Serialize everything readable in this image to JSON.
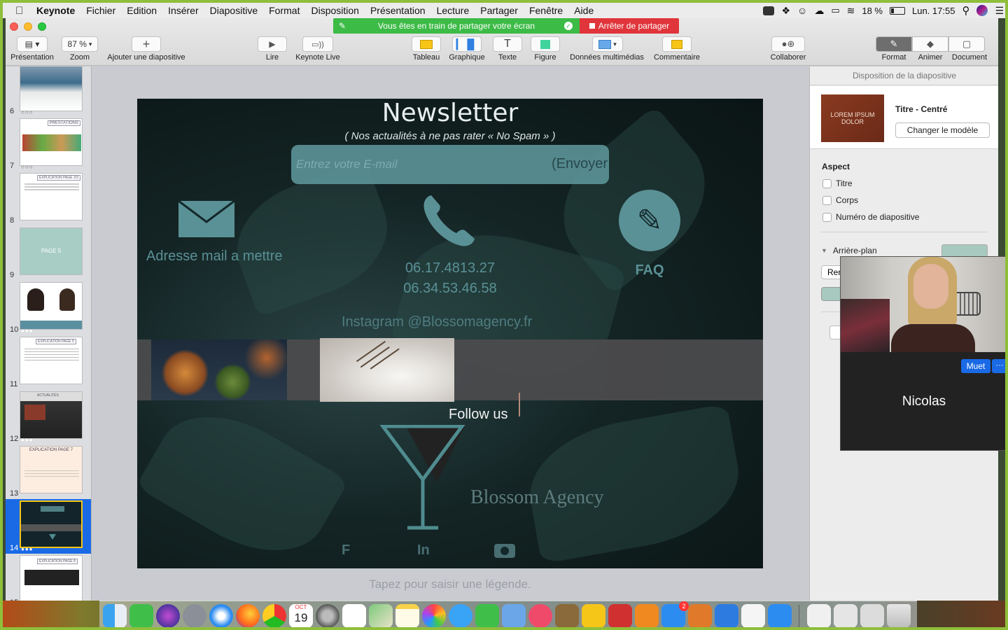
{
  "menubar": {
    "app": "Keynote",
    "items": [
      "Fichier",
      "Edition",
      "Insérer",
      "Diapositive",
      "Format",
      "Disposition",
      "Présentation",
      "Lecture",
      "Partager",
      "Fenêtre",
      "Aide"
    ],
    "battery": "18 %",
    "clock": "Lun. 17:55"
  },
  "share_banner": {
    "text": "Vous êtes en train de partager votre écran",
    "stop": "Arrêter de partager"
  },
  "toolbar": {
    "presentation": "Présentation",
    "zoom_value": "87 %",
    "zoom": "Zoom",
    "add_slide": "Ajouter une diapositive",
    "play": "Lire",
    "keynote_live": "Keynote Live",
    "table": "Tableau",
    "chart": "Graphique",
    "text": "Texte",
    "shape": "Figure",
    "media": "Données multimédias",
    "comment": "Commentaire",
    "collaborate": "Collaborer",
    "format": "Format",
    "animate": "Animer",
    "document": "Document"
  },
  "slides": [
    {
      "num": "6",
      "title": ""
    },
    {
      "num": "7",
      "title": "PRESTATIONS"
    },
    {
      "num": "8",
      "title": "EXPLICATION PAGE 2/3"
    },
    {
      "num": "9",
      "title": "PAGE 5"
    },
    {
      "num": "10",
      "title": ""
    },
    {
      "num": "11",
      "title": "EXPLICATION PAGE 5"
    },
    {
      "num": "12",
      "title": "ACTUALITÉS"
    },
    {
      "num": "13",
      "title": "EXPLICATION PAGE 7"
    },
    {
      "num": "14",
      "title": ""
    },
    {
      "num": "15",
      "title": "EXPLICATION PAGE 8"
    }
  ],
  "slide": {
    "title": "Newsletter",
    "subtitle": "( Nos actualités à ne pas rater « No Spam » )",
    "email_placeholder": "Entrez votre E-mail",
    "send": "(Envoyer",
    "mail_label": "Adresse mail a mettre",
    "phone1": "06.17.4813.27",
    "phone2": "06.34.53.46.58",
    "faq": "FAQ",
    "instagram": "Instagram @Blossomagency.fr",
    "follow": "Follow us",
    "brand": "Blossom Agency",
    "social_f": "F",
    "social_in": "In",
    "accent": "#5a9196"
  },
  "caption": "Tapez pour saisir une légende.",
  "inspector": {
    "header": "Disposition de la diapositive",
    "layout_thumb": "LOREM IPSUM DOLOR",
    "layout_name": "Titre - Centré",
    "change_layout": "Changer le modèle",
    "aspect": "Aspect",
    "cb_title": "Titre",
    "cb_body": "Corps",
    "cb_number": "Numéro de diapositive",
    "background": "Arrière-plan",
    "rem_clip": "Ren"
  },
  "video": {
    "name": "Nicolas",
    "mute": "Muet",
    "more": "···"
  },
  "dock": {
    "calendar_month": "OCT",
    "calendar_day": "19",
    "badge": "2"
  }
}
